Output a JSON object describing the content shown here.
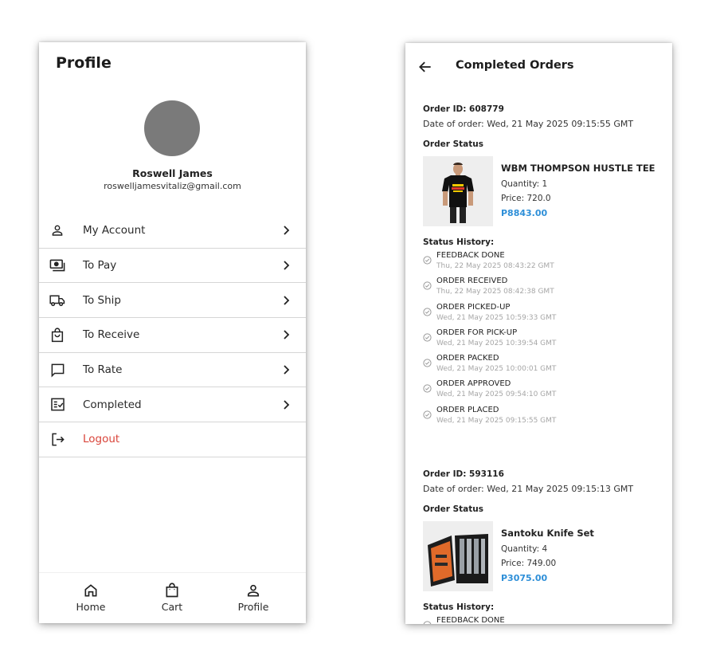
{
  "profile": {
    "title": "Profile",
    "user_name": "Roswell James",
    "user_email": "roswelljamesvitaliz@gmail.com",
    "menu": [
      {
        "label": "My Account",
        "icon": "person-icon"
      },
      {
        "label": "To Pay",
        "icon": "money-icon"
      },
      {
        "label": "To Ship",
        "icon": "truck-icon"
      },
      {
        "label": "To Receive",
        "icon": "shopping-bag-icon"
      },
      {
        "label": "To Rate",
        "icon": "chat-bubble-icon"
      },
      {
        "label": "Completed",
        "icon": "checklist-icon"
      },
      {
        "label": "Logout",
        "icon": "logout-icon"
      }
    ],
    "bottom_nav": [
      {
        "label": "Home",
        "icon": "home-icon"
      },
      {
        "label": "Cart",
        "icon": "bag-icon"
      },
      {
        "label": "Profile",
        "icon": "person-icon"
      }
    ],
    "logout_color": "#d9443a"
  },
  "completed_orders": {
    "title": "Completed Orders",
    "accent_color": "#2e8fd8",
    "orders": [
      {
        "order_id": "Order ID: 608779",
        "date": "Date of order: Wed, 21 May 2025 09:15:55 GMT",
        "status_label": "Order Status",
        "product_name": "WBM THOMPSON HUSTLE TEE",
        "quantity": "Quantity: 1",
        "price": "Price: 720.0",
        "total": "P8843.00",
        "history_label": "Status History:",
        "history": [
          {
            "status": "FEEDBACK DONE",
            "time": "Thu, 22 May 2025 08:43:22 GMT"
          },
          {
            "status": "ORDER RECEIVED",
            "time": "Thu, 22 May 2025 08:42:38 GMT"
          },
          {
            "status": "ORDER PICKED-UP",
            "time": "Wed, 21 May 2025 10:59:33 GMT"
          },
          {
            "status": "ORDER FOR PICK-UP",
            "time": "Wed, 21 May 2025 10:39:54 GMT"
          },
          {
            "status": "ORDER PACKED",
            "time": "Wed, 21 May 2025 10:00:01 GMT"
          },
          {
            "status": "ORDER APPROVED",
            "time": "Wed, 21 May 2025 09:54:10 GMT"
          },
          {
            "status": "ORDER PLACED",
            "time": "Wed, 21 May 2025 09:15:55 GMT"
          }
        ]
      },
      {
        "order_id": "Order ID: 593116",
        "date": "Date of order: Wed, 21 May 2025 09:15:13 GMT",
        "status_label": "Order Status",
        "product_name": "Santoku Knife Set",
        "quantity": "Quantity: 4",
        "price": "Price: 749.00",
        "total": "P3075.00",
        "history_label": "Status History:",
        "history": [
          {
            "status": "FEEDBACK DONE",
            "time": ""
          }
        ]
      }
    ]
  }
}
